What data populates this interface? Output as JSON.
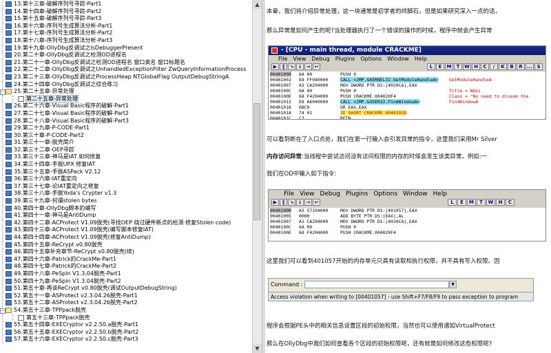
{
  "toc": {
    "items": [
      {
        "label": "13.第十三章-破解序列号寻踪-Part1",
        "type": "book",
        "level": 1
      },
      {
        "label": "14.第十四章-破解序列号寻踪-Part2",
        "type": "book",
        "level": 1
      },
      {
        "label": "15.第十五章-破解序列号寻踪-Part3",
        "type": "book",
        "level": 1
      },
      {
        "label": "16.第十六章-序列号生成算法分析-Part1",
        "type": "book",
        "level": 1
      },
      {
        "label": "17.第十七章-序列号生成算法分析-Part2",
        "type": "book",
        "level": 1
      },
      {
        "label": "18.第十八章-序列号生成算法分析-Part3",
        "type": "book",
        "level": 1
      },
      {
        "label": "19.第十九章-OllyDbg反调试之IsDebuggerPresent",
        "type": "book",
        "level": 1
      },
      {
        "label": "20.第二十章-OllyDbg反调试之检测OD进程名",
        "type": "book",
        "level": 1
      },
      {
        "label": "21.第二十一章-OllyDbg反调试之检测OD进程名 窗口类名 窗口标题名",
        "type": "book",
        "level": 1
      },
      {
        "label": "22.第二十二章-OllyDbg反调试之UnhandledExceptionFilter ZwQueryInformationProcess",
        "type": "book",
        "level": 1
      },
      {
        "label": "23.第二十三章-OllyDbg反调试之ProcessHeap NTGlobalFlag OutputDebugStringA",
        "type": "book",
        "level": 1
      },
      {
        "label": "24.第二十四章-OllyDbg反调试之综合练习",
        "type": "book",
        "level": 1
      },
      {
        "label": "25.第二十五章-异常处理",
        "type": "open",
        "level": 1
      },
      {
        "label": "第二十五章-异常处理",
        "type": "page",
        "level": 2,
        "selected": true
      },
      {
        "label": "26.第二十六章-Visual Basic程序的破解-Part1",
        "type": "book",
        "level": 1
      },
      {
        "label": "27.第二十七章-Visual Basic程序的破解-Part2",
        "type": "book",
        "level": 1
      },
      {
        "label": "28.第二十八章-Visual Basic程序的破解-Part3",
        "type": "book",
        "level": 1
      },
      {
        "label": "29.第二十九章-P-CODE-Part1",
        "type": "book",
        "level": 1
      },
      {
        "label": "30.第三十章-P-CODE-Part2",
        "type": "book",
        "level": 1
      },
      {
        "label": "31.第三十一章-脱壳简介",
        "type": "book",
        "level": 1
      },
      {
        "label": "32.第三十二章-OEP寻踪",
        "type": "book",
        "level": 1
      },
      {
        "label": "33.第三十三章-神马是IAT 如何修复",
        "type": "book",
        "level": 1
      },
      {
        "label": "34.第三十四章-手脱UPX 修复IAT",
        "type": "book",
        "level": 1
      },
      {
        "label": "35.第三十五章-手脱ASPack V2.12",
        "type": "book",
        "level": 1
      },
      {
        "label": "36.第三十六章-IAT重定向",
        "type": "book",
        "level": 1
      },
      {
        "label": "37.第三十七章-论IAT重定向之修复",
        "type": "book",
        "level": 1
      },
      {
        "label": "38.第三十八章-手脱Yoda's Crypter v1.3",
        "type": "book",
        "level": 1
      },
      {
        "label": "39.第三十九章-何谓stolen bytes",
        "type": "book",
        "level": 1
      },
      {
        "label": "40.第四十章-OllyDbg脚本的编写",
        "type": "book",
        "level": 1
      },
      {
        "label": "41.第四十一章-神马是AntiDump",
        "type": "book",
        "level": 1
      },
      {
        "label": "42.第四十二章-ACProtect V1.09脱壳(寻找OEP 绕过硬件断点的检测 修复Stolen code)",
        "type": "book",
        "level": 1
      },
      {
        "label": "43.第四十三章-ACProtect V1.09脱壳(编写脚本修复IAT)",
        "type": "book",
        "level": 1
      },
      {
        "label": "44.第四十四章-ACProtect V1.09脱壳(修复AntiDump)",
        "type": "book",
        "level": 1
      },
      {
        "label": "45.第四十五章-ReCrypt v0.80脱壳",
        "type": "book",
        "level": 1
      },
      {
        "label": "46.第四十五章补充章节-ReCrypt v0.80脱壳(续)",
        "type": "book",
        "level": 1
      },
      {
        "label": "47.第四十六章-Patrick的CrackMe-Part1",
        "type": "book",
        "level": 1
      },
      {
        "label": "48.第四十七章-Patrick的CrackMe-Part2",
        "type": "book",
        "level": 1
      },
      {
        "label": "49.第四十八章-PeSpin V1.3.04脱壳-Part1",
        "type": "book",
        "level": 1
      },
      {
        "label": "50.第四十九章-PeSpin V1.3.04脱壳-Part2",
        "type": "book",
        "level": 1
      },
      {
        "label": "51.第五十章-再谈ReCrypt v0.80脱壳(调试OutputDebugString)",
        "type": "book",
        "level": 1
      },
      {
        "label": "52.第五十一章-ASProtect v2.3.04.26脱壳-Part1",
        "type": "book",
        "level": 1
      },
      {
        "label": "53.第五十二章-ASProtect v2.3.04.26脱壳-Part2",
        "type": "book",
        "level": 1
      },
      {
        "label": "54.第五十三章-TPPpack脱壳",
        "type": "open",
        "level": 1
      },
      {
        "label": "第五十三章-TPPpack脱壳",
        "type": "page",
        "level": 2
      },
      {
        "label": "55.第五十四章-EXECryptor v2.2.50.a脱壳-Part1",
        "type": "book",
        "level": 1
      },
      {
        "label": "56.第五十五章-EXECryptor v2.2.50.b脱壳-Part2",
        "type": "book",
        "level": 1
      },
      {
        "label": "57.第五十六章-EXECryptor v2.2.50.c脱壳-Part3",
        "type": "book",
        "level": 1
      }
    ]
  },
  "article": {
    "p1": "本章，我们将介绍异常处理，这一块通常是初学者的绊脚石，但是如果研究深入一点的话，",
    "p2": "那么异常是如何产生的呢?当处理器执行了一个错误的操作的时候，程序中就会产生异常",
    "p3": "可以看到断在了入口点处，我们在第一行输入会引发异常的指令，这里我们采用Mr Silver",
    "p4_bold": "内存访问异常",
    "p4": ":当线程中尝试访问没有访问权限的内存的时候会发生该类异常。例如:一",
    "p5": "我们在OD中输入如下指令:",
    "p6": "这里我们可以看到401057开始的内存单元只具有读取和执行权限，并不具有写入权限。因",
    "p7": "程序会根据PE头中的相关信息设置区段的初始权限，当然也可以使用诸如VirtualProtect",
    "p8": "那么在OllyDbg中我们如何查看各个区段的初始权限呢，还有就是如何修改这些权限呢?"
  },
  "cpu_window": {
    "title": "- [CPU - main thread, module CRACKME]",
    "menu": [
      "File",
      "View",
      "Debug",
      "Plugins",
      "Options",
      "Window",
      "Help"
    ],
    "toolbar_letters": [
      "L",
      "E",
      "M",
      "T",
      "W",
      "H",
      "C",
      "/",
      "K",
      "B",
      "R",
      "...",
      "S"
    ],
    "rows": [
      {
        "addr": "00401000",
        "hex": "6A 00",
        "asm": "PUSH 0",
        "cmt": ""
      },
      {
        "addr": "00401002",
        "hex": "E8 FF040000",
        "asm": "CALL <JMP.&KERNEL32.GetModuleHandleA>",
        "cmt": "GetModuleHandleA"
      },
      {
        "addr": "00401007",
        "hex": "A3 CA204000",
        "asm": "MOV DWORD PTR DS:[4020CA],EAX",
        "cmt": ""
      },
      {
        "addr": "0040100C",
        "hex": "6A 00",
        "asm": "PUSH 0",
        "cmt": "Title = NULL"
      },
      {
        "addr": "0040100E",
        "hex": "68 F4204000",
        "asm": "PUSH CRACKME.004020F4",
        "cmt": "Class = \"No need to disasm the"
      },
      {
        "addr": "00401013",
        "hex": "E8 A6040000",
        "asm": "CALL <JMP.&USER32.FindWindowA>",
        "cmt": "FindWindowA"
      },
      {
        "addr": "00401018",
        "hex": "0BC0",
        "asm": "OR EAX,EAX",
        "cmt": ""
      },
      {
        "addr": "0040101A",
        "hex": "74 01",
        "asm": "JE SHORT CRACKME.0040101D",
        "cmt": ""
      },
      {
        "addr": "0040101C",
        "hex": "C3",
        "asm": "RETN",
        "cmt": ""
      }
    ]
  },
  "od_window": {
    "menu": [
      "File",
      "View",
      "Debug",
      "Plugins",
      "Options",
      "Window",
      "Help"
    ],
    "toolbar_letters": [
      "L",
      "E",
      "M",
      "T",
      "W",
      "H",
      "C"
    ],
    "rows": [
      {
        "addr": "00401000",
        "hex": "A3 57104000",
        "asm": "MOV DWORD PTR DS:[401057],EAX"
      },
      {
        "addr": "00401005",
        "hex": "0000",
        "asm": "ADD BYTE PTR DS:[EAX],AL"
      },
      {
        "addr": "00401007",
        "hex": "A3 CA204000",
        "asm": "MOV DWORD PTR DS:[4020CA],EAX"
      },
      {
        "addr": "0040100C",
        "hex": "6A 00",
        "asm": "PUSH 0"
      },
      {
        "addr": "0040100E",
        "hex": "68 F4204000",
        "asm": "PUSH CRACKME.004020F4"
      }
    ]
  },
  "command_bar": {
    "label": "Command :",
    "message": "Access violation when writing to [00401057] - use Shift+F7/F8/F9 to pass exception to program"
  },
  "colors": {
    "title_bg": "#0b1a66",
    "highlight": "#8bdcf6",
    "call_highlight": "#f8f060",
    "selection": "#dfe8f4"
  }
}
